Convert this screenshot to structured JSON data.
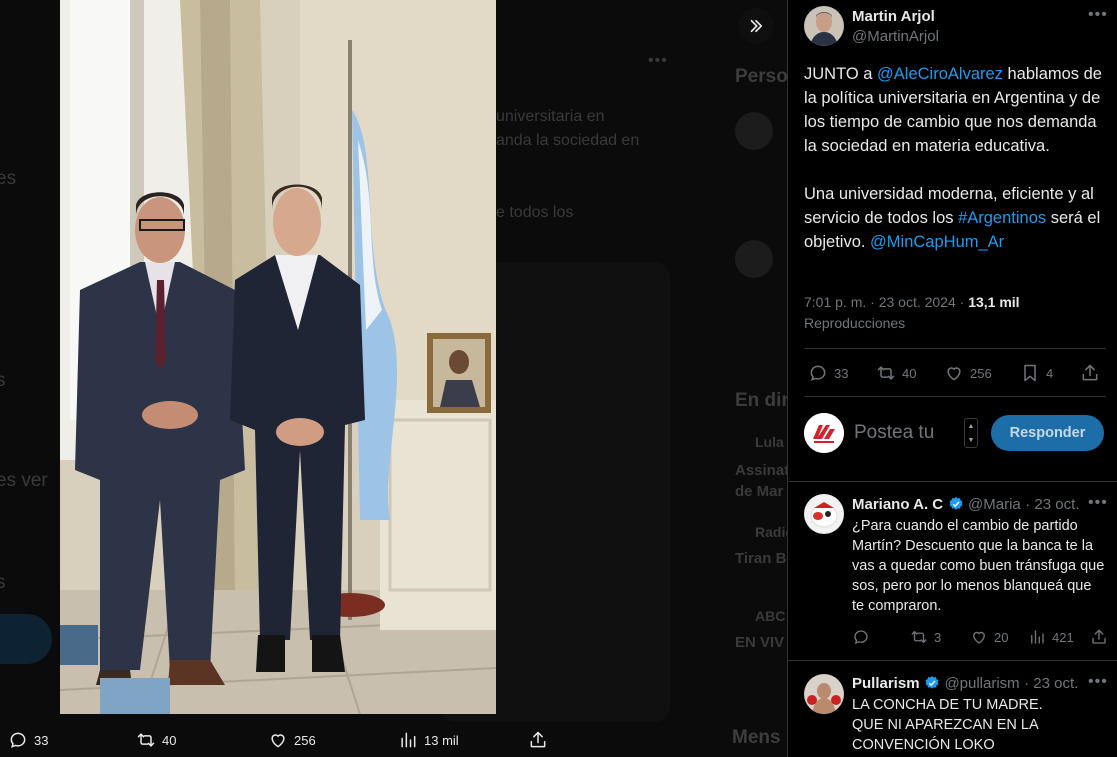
{
  "background": {
    "heading_persons": "Perso",
    "heading_en_directo": "En dir",
    "snippet_line1": "universitaria en",
    "snippet_line2": "anda la sociedad en",
    "snippet_line3": "e todos los",
    "left_es": "es",
    "left_s": "s",
    "left_es_ver": "es ver",
    "left_s2": "s",
    "live_item1_source": "Lula",
    "live_item1_line1": "Assinat",
    "live_item1_line2": "de Mar",
    "live_item2_source": "Radio",
    "live_item2_line1": "Tiran B",
    "live_item3_source": "ABC",
    "live_item3_line1": "EN VIV",
    "mens": "Mens"
  },
  "media_actions": {
    "replies": "33",
    "reposts": "40",
    "likes": "256",
    "views": "13 mil"
  },
  "tweet": {
    "author_name": "Martin Arjol",
    "author_handle": "@MartinArjol",
    "text_part1": "JUNTO a ",
    "mention1": "@AleCiroAlvarez",
    "text_part2": " hablamos de la política universitaria en Argentina y de los tiempo de cambio que nos demanda la sociedad en materia educativa.",
    "text_part3": "Una universidad moderna, eficiente y al servicio de todos los ",
    "hashtag1": "#Argentinos",
    "text_part4": " será el objetivo. ",
    "mention2": "@MinCapHum_Ar",
    "timestamp": "7:01 p. m. · 23 oct. 2024 · ",
    "views_count": "13,1 mil",
    "views_label": "Reproducciones",
    "replies": "33",
    "reposts": "40",
    "likes": "256",
    "bookmarks": "4"
  },
  "composer": {
    "placeholder": "Postea tu",
    "reply_button": "Responder"
  },
  "replies": [
    {
      "name": "Mariano A. C",
      "handle": "@Maria",
      "date": "· 23 oct.",
      "text": "¿Para cuando el cambio de partido Martín? Descuento que la banca te la vas a quedar como buen tránsfuga que sos, pero por lo menos blanqueá que te compraron.",
      "replies": "",
      "reposts": "3",
      "likes": "20",
      "views": "421"
    },
    {
      "name": "Pullarism",
      "handle": "@pullarism",
      "date": "· 23 oct.",
      "text_line1": "LA CONCHA DE TU MADRE.",
      "text_line2": "QUE NI APAREZCAN EN LA",
      "text_line3": "CONVENCIÓN LOKO"
    }
  ],
  "colors": {
    "accent": "#1d9bf0",
    "verified": "#1d9bf0",
    "muted": "#71767b"
  }
}
